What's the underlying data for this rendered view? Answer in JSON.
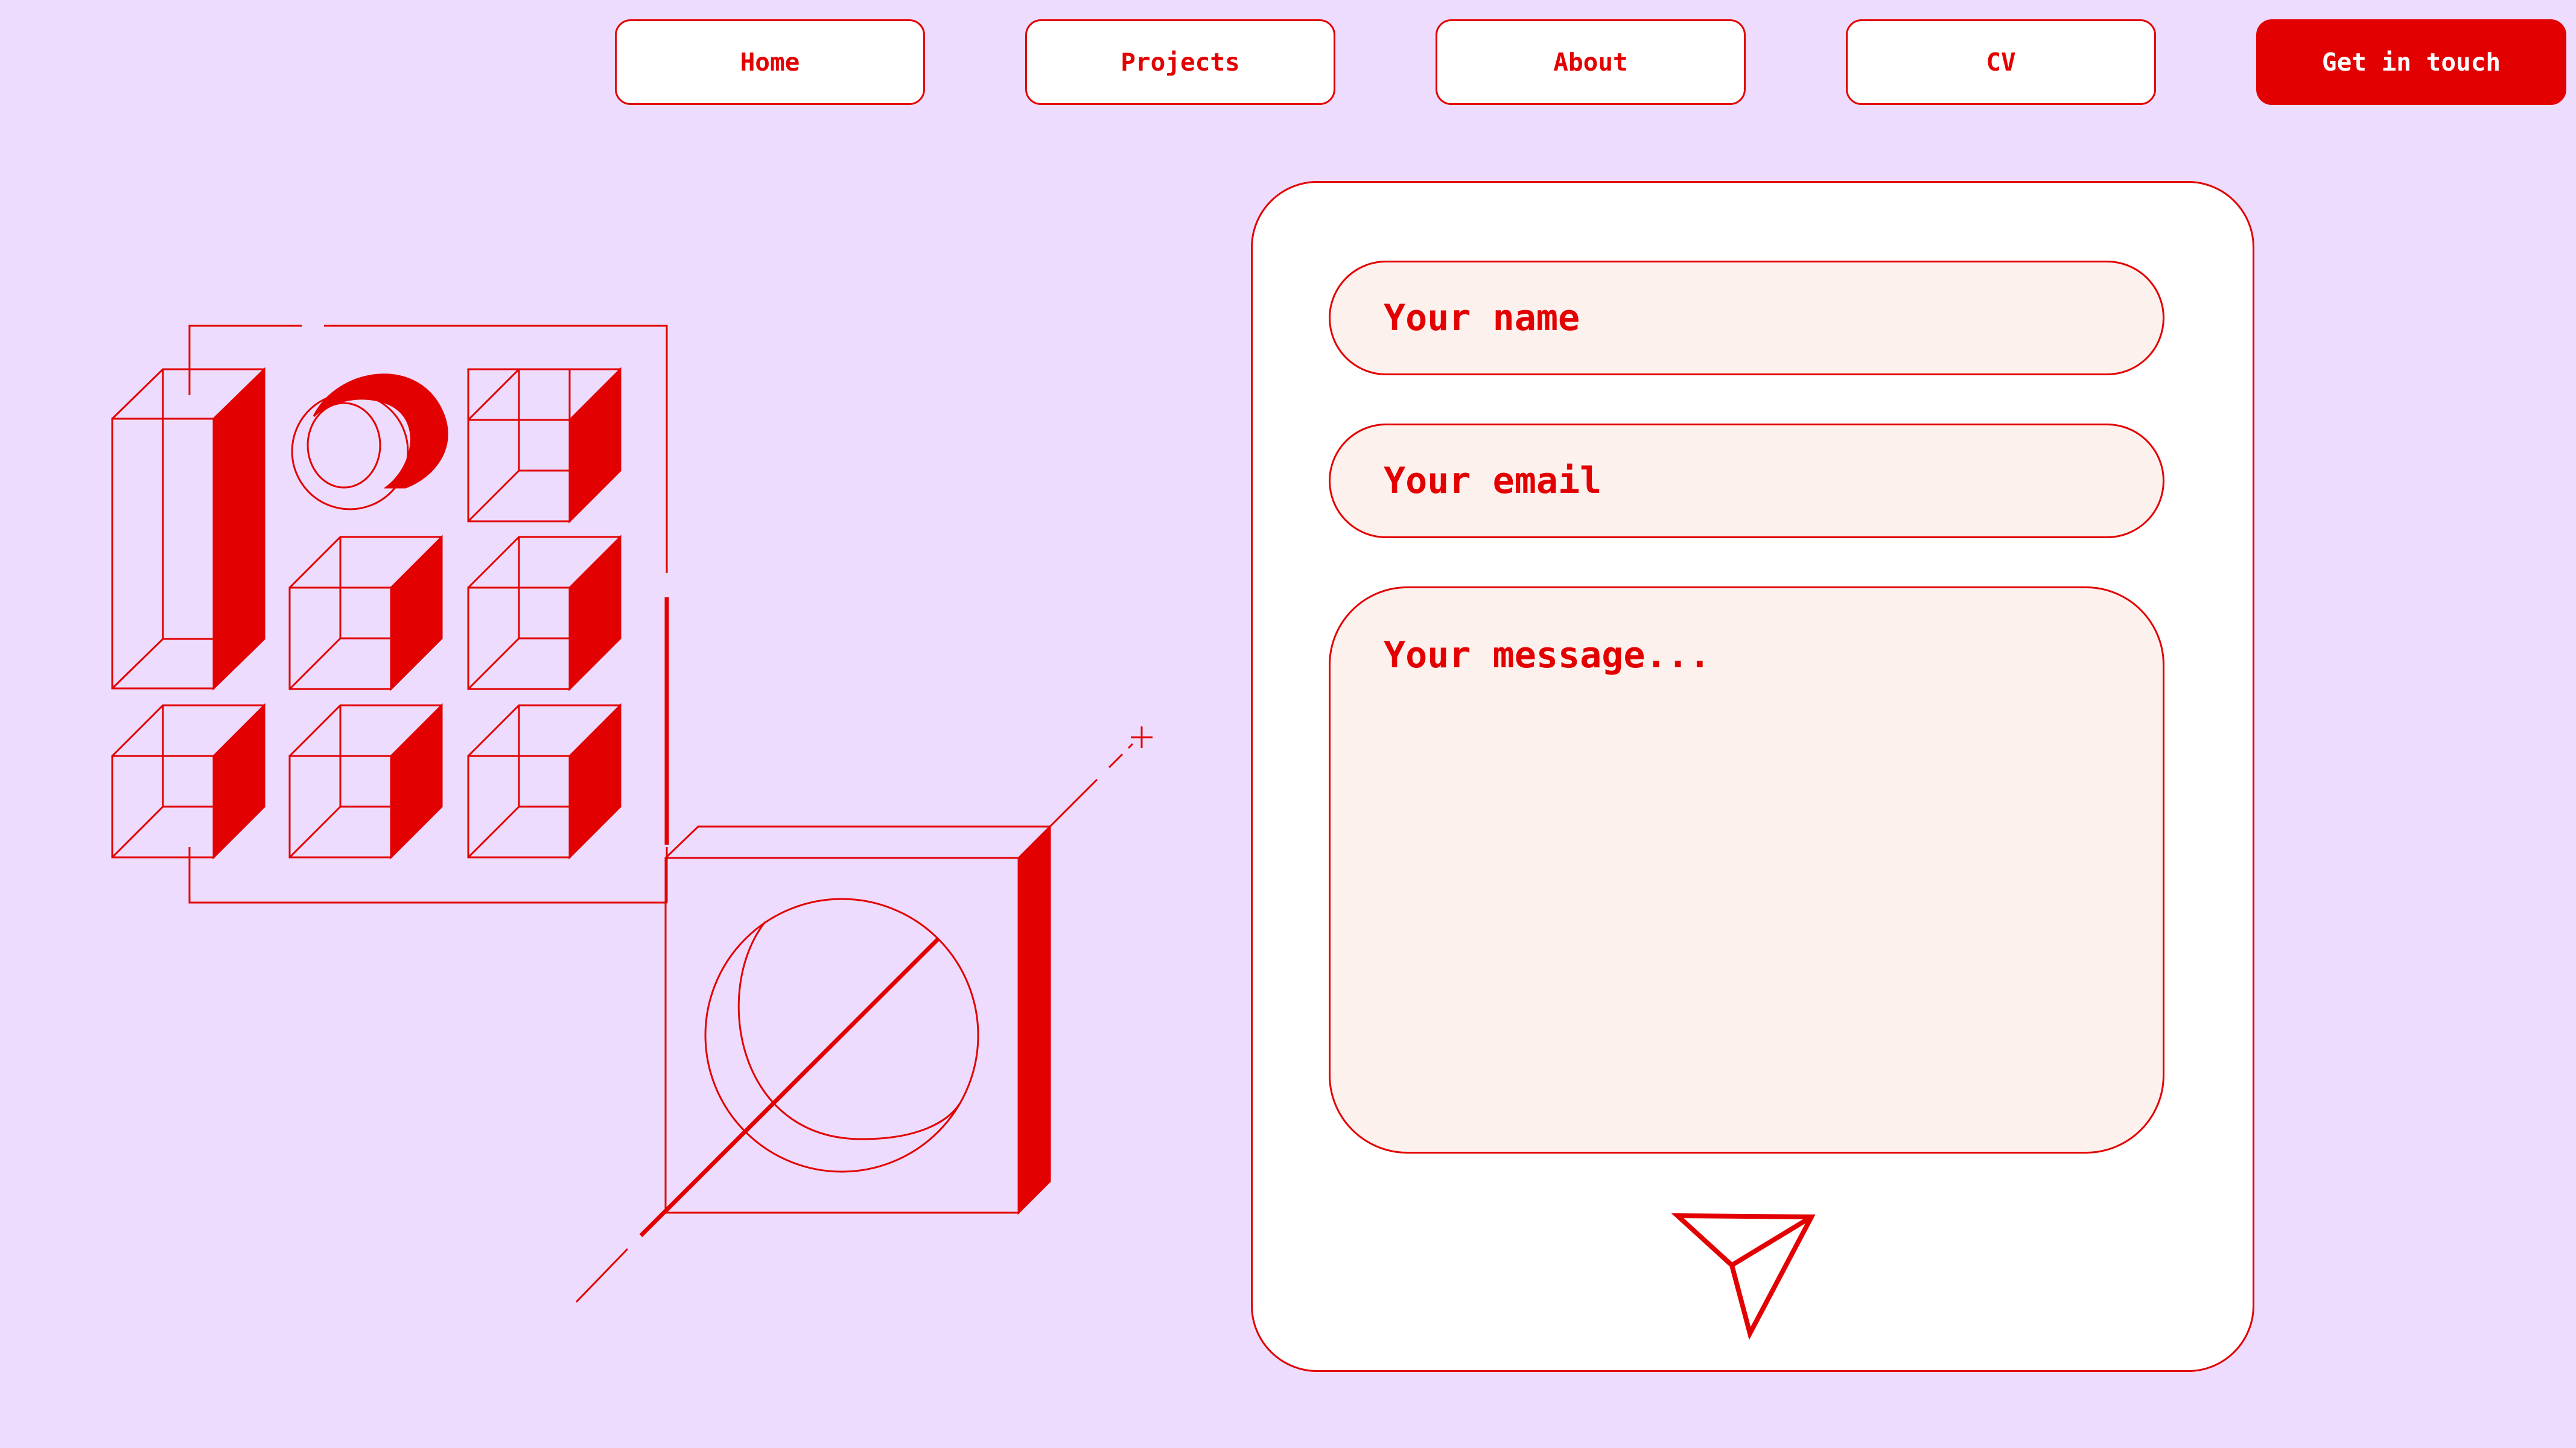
{
  "nav": {
    "items": [
      {
        "label": "Home"
      },
      {
        "label": "Projects"
      },
      {
        "label": "About"
      },
      {
        "label": "CV"
      },
      {
        "label": "Get in touch"
      }
    ]
  },
  "form": {
    "name_placeholder": "Your name",
    "email_placeholder": "Your email",
    "message_placeholder": "Your message..."
  },
  "send_icon": "paper-plane-icon",
  "colors": {
    "accent": "#e30000",
    "background": "#eddcfd",
    "field_fill": "#fdf1ee",
    "card": "#ffffff"
  }
}
